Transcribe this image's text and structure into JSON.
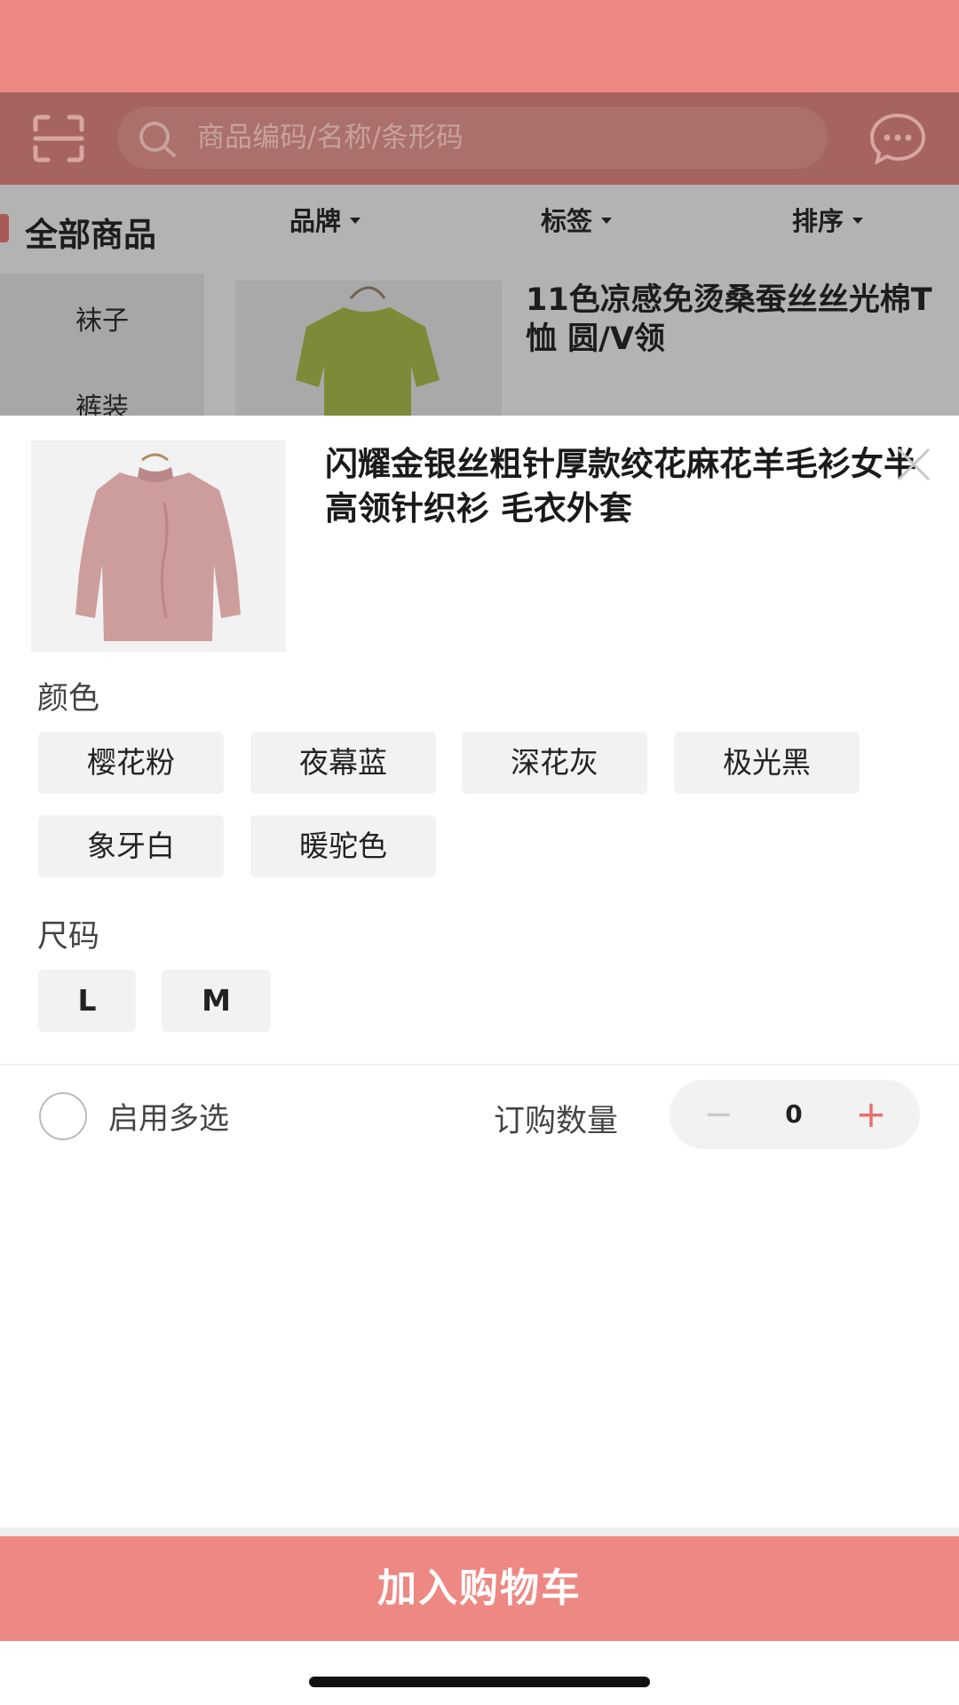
{
  "background": {
    "search_placeholder": "商品编码/名称/条形码",
    "category_title": "全部商品",
    "filters": [
      "品牌",
      "标签",
      "排序"
    ],
    "side_menu": [
      "袜子",
      "裤装"
    ],
    "bg_product_title": "11色凉感免烫桑蚕丝丝光棉T恤 圆/V领"
  },
  "sheet": {
    "product_title": "闪耀金银丝粗针厚款绞花麻花羊毛衫女半高领针织衫 毛衣外套",
    "color_label": "颜色",
    "colors": [
      "樱花粉",
      "夜幕蓝",
      "深花灰",
      "极光黑",
      "象牙白",
      "暖驼色"
    ],
    "size_label": "尺码",
    "sizes": [
      "L",
      "M"
    ],
    "multi_select_label": "启用多选",
    "quantity_label": "订购数量",
    "quantity_value": "0",
    "minus_symbol": "−",
    "plus_symbol": "+",
    "add_to_cart_label": "加入购物车"
  },
  "colors": {
    "accent": "#ee8882",
    "plus": "#e8716c"
  }
}
